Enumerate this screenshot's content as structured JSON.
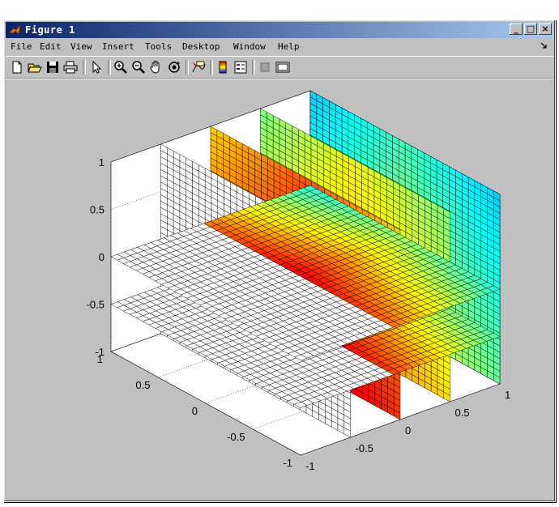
{
  "window": {
    "title": "Figure 1",
    "controls": {
      "minimize": "_",
      "maximize": "□",
      "close": "×"
    }
  },
  "menubar": {
    "items": [
      "File",
      "Edit",
      "View",
      "Insert",
      "Tools",
      "Desktop",
      "Window",
      "Help"
    ]
  },
  "toolbar": {
    "buttons": [
      {
        "icon": "new-figure-icon"
      },
      {
        "icon": "open-file-icon"
      },
      {
        "icon": "save-icon"
      },
      {
        "icon": "print-icon"
      },
      {
        "icon": "edit-plot-arrow-icon"
      },
      {
        "icon": "zoom-in-icon"
      },
      {
        "icon": "zoom-out-icon"
      },
      {
        "icon": "pan-hand-icon"
      },
      {
        "icon": "rotate-3d-icon"
      },
      {
        "icon": "data-cursor-icon"
      },
      {
        "icon": "insert-colorbar-icon"
      },
      {
        "icon": "insert-legend-icon"
      },
      {
        "icon": "hide-plot-tools-icon"
      },
      {
        "icon": "show-plot-tools-icon"
      }
    ]
  },
  "chart_data": {
    "type": "slice",
    "description_type": "3D volume slice plot",
    "colormap": "jet",
    "xlim": [
      -1,
      1
    ],
    "ylim": [
      -1,
      1
    ],
    "zlim": [
      -1,
      1
    ],
    "xticks": [
      "-1",
      "-0.5",
      "0",
      "0.5",
      "1"
    ],
    "yticks": [
      "-1",
      "-0.5",
      "0",
      "0.5",
      "1"
    ],
    "zticks": [
      "-1",
      "-0.5",
      "0",
      "0.5",
      "1"
    ],
    "grid": true,
    "slices": {
      "x": [
        -0.5,
        0,
        0.5,
        1
      ],
      "z": [
        -0.5,
        0
      ]
    }
  }
}
